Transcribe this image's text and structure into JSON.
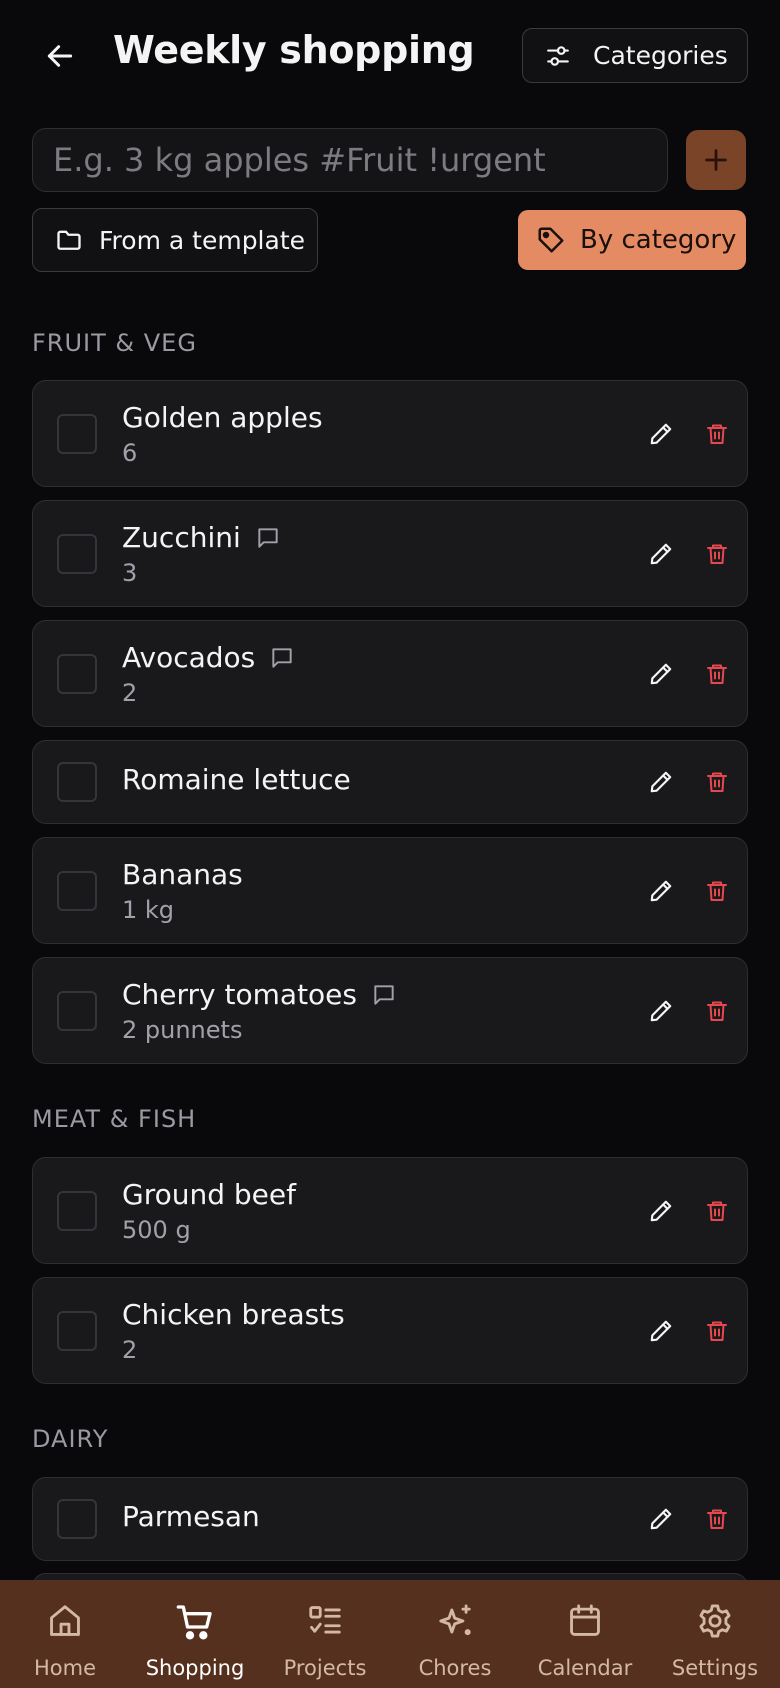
{
  "header": {
    "title": "Weekly shopping",
    "categories_label": "Categories"
  },
  "add_item": {
    "placeholder": "E.g. 3 kg apples #Fruit !urgent"
  },
  "actions": {
    "template_label": "From a template",
    "by_category_label": "By category"
  },
  "sections": [
    {
      "title": "FRUIT & VEG",
      "items": [
        {
          "name": "Golden apples",
          "qty": "6",
          "has_comment": false
        },
        {
          "name": "Zucchini",
          "qty": "3",
          "has_comment": true
        },
        {
          "name": "Avocados",
          "qty": "2",
          "has_comment": true
        },
        {
          "name": "Romaine lettuce",
          "qty": "",
          "has_comment": false
        },
        {
          "name": "Bananas",
          "qty": "1 kg",
          "has_comment": false
        },
        {
          "name": "Cherry tomatoes",
          "qty": "2 punnets",
          "has_comment": true
        }
      ]
    },
    {
      "title": "MEAT & FISH",
      "items": [
        {
          "name": "Ground beef",
          "qty": "500 g",
          "has_comment": false
        },
        {
          "name": "Chicken breasts",
          "qty": "2",
          "has_comment": false
        }
      ]
    },
    {
      "title": "DAIRY",
      "items": [
        {
          "name": "Parmesan",
          "qty": "",
          "has_comment": false
        }
      ]
    }
  ],
  "nav": {
    "items": [
      {
        "label": "Home",
        "icon": "home-icon"
      },
      {
        "label": "Shopping",
        "icon": "cart-icon",
        "active": true
      },
      {
        "label": "Projects",
        "icon": "list-checks-icon"
      },
      {
        "label": "Chores",
        "icon": "sparkles-icon"
      },
      {
        "label": "Calendar",
        "icon": "calendar-icon"
      },
      {
        "label": "Settings",
        "icon": "gear-icon"
      }
    ]
  },
  "colors": {
    "accent": "#e48b63",
    "add_button": "#7a4428",
    "nav_background": "#56301e",
    "delete": "#e5484d",
    "background": "#09090b",
    "card": "#19191c"
  }
}
